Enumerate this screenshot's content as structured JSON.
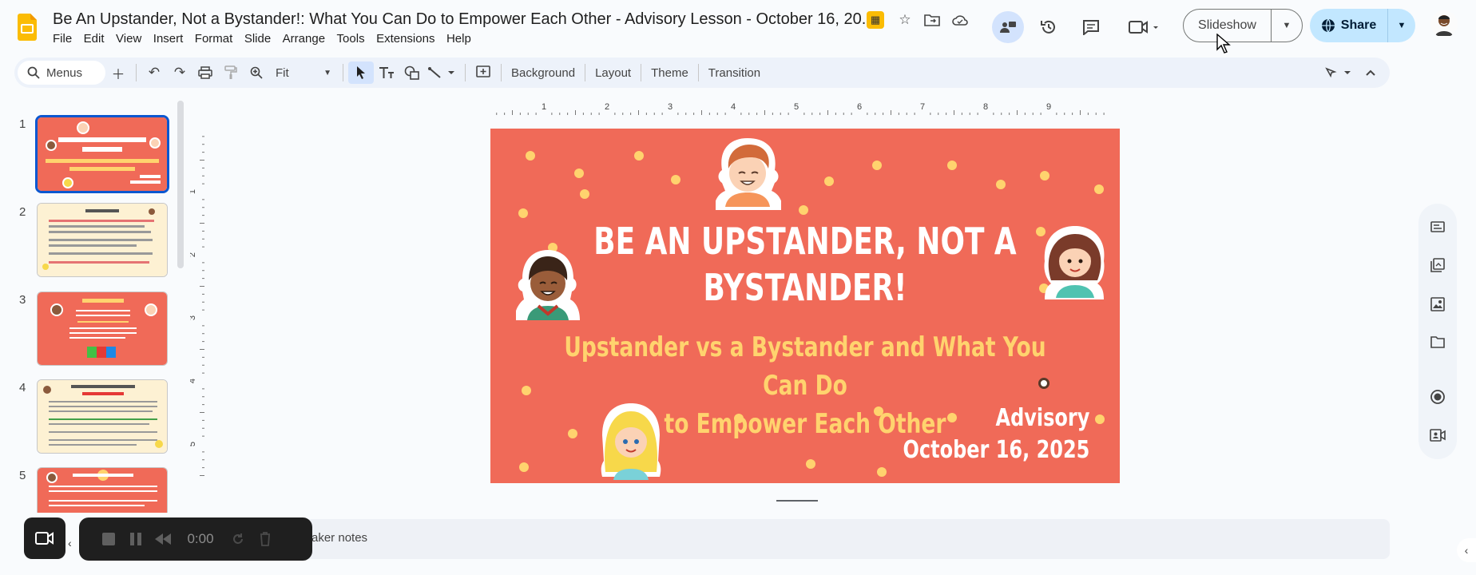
{
  "app": {
    "title": "Be An Upstander, Not a Bystander!: What You Can Do to Empower Each Other - Advisory Lesson - October 16, 20...",
    "menu": [
      "File",
      "Edit",
      "View",
      "Insert",
      "Format",
      "Slide",
      "Arrange",
      "Tools",
      "Extensions",
      "Help"
    ],
    "slideshow_label": "Slideshow",
    "share_label": "Share"
  },
  "toolbar": {
    "search_label": "Menus",
    "zoom_value": "Fit",
    "background_label": "Background",
    "layout_label": "Layout",
    "theme_label": "Theme",
    "transition_label": "Transition"
  },
  "rulers": {
    "horizontal": [
      "1",
      "2",
      "3",
      "4",
      "5",
      "6",
      "7",
      "8",
      "9"
    ],
    "vertical": [
      "1",
      "2",
      "3",
      "4",
      "5"
    ]
  },
  "filmstrip": {
    "slides": [
      {
        "num": "1",
        "title": "BE AN UPSTANDER, NOT A BYSTANDER!",
        "bg": "#f06a58"
      },
      {
        "num": "2",
        "title": "REMEMBER...",
        "bg": "#fdf1d3"
      },
      {
        "num": "3",
        "title": "",
        "bg": "#f06a58"
      },
      {
        "num": "4",
        "title": "BYSTANDER VS UPSTANDER",
        "bg": "#fdf1d3"
      },
      {
        "num": "5",
        "title": "",
        "bg": "#f06a58"
      }
    ]
  },
  "slide": {
    "title_line1": "BE AN UPSTANDER, NOT A",
    "title_line2": "BYSTANDER!",
    "subtitle_line1": "Upstander vs a Bystander and What You Can Do",
    "subtitle_line2": "to Empower Each Other",
    "advisory": "Advisory",
    "date": "October 16, 2025"
  },
  "notes": {
    "label": "aker notes"
  },
  "recorder": {
    "time": "0:00"
  },
  "colors": {
    "slide_bg": "#f06a58",
    "slide_accent": "#ffd36e",
    "share_bg": "#c2e7ff",
    "selected": "#0b57d0"
  }
}
